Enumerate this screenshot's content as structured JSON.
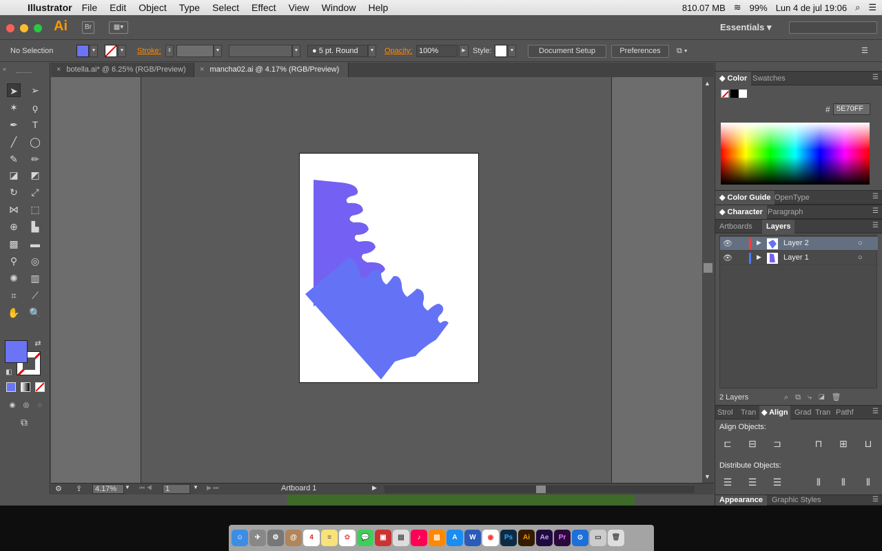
{
  "menubar": {
    "app": "Illustrator",
    "items": [
      "File",
      "Edit",
      "Object",
      "Type",
      "Select",
      "Effect",
      "View",
      "Window",
      "Help"
    ],
    "memory": "810.07 MB",
    "battery": "99%",
    "datetime": "Lun 4 de jul  19:06"
  },
  "titlebar": {
    "logo": "Ai",
    "bridge": "Br",
    "workspace": "Essentials"
  },
  "control": {
    "selection": "No Selection",
    "fill_color": "#6b74f5",
    "stroke_label": "Stroke:",
    "brush": "5 pt. Round",
    "opacity_label": "Opacity:",
    "opacity": "100%",
    "style_label": "Style:",
    "document_setup": "Document Setup",
    "preferences": "Preferences"
  },
  "tabs": [
    {
      "label": "botella.ai* @ 6.25% (RGB/Preview)",
      "active": false
    },
    {
      "label": "mancha02.ai @ 4.17% (RGB/Preview)",
      "active": true
    }
  ],
  "status": {
    "zoom": "4.17%",
    "page": "1",
    "artboard": "Artboard 1"
  },
  "color_panel": {
    "tabs": [
      "Color",
      "Swatches"
    ],
    "hex_symbol": "#",
    "hex": "5E70FF"
  },
  "panels": {
    "color_guide_tabs": [
      "Color Guide",
      "OpenType"
    ],
    "character_tabs": [
      "Character",
      "Paragraph"
    ],
    "layers_tabs": [
      "Artboards",
      "Layers"
    ],
    "layers": [
      {
        "name": "Layer 2",
        "color": "#ff3b3b",
        "active": true
      },
      {
        "name": "Layer 1",
        "color": "#4a7bff",
        "active": false
      }
    ],
    "layers_count": "2 Layers",
    "lower_tabs": [
      "Strol",
      "Tran",
      "Align",
      "Grad",
      "Tran",
      "Pathf"
    ],
    "align_objects": "Align Objects:",
    "distribute_objects": "Distribute Objects:",
    "bottom_tabs": [
      "Appearance",
      "Graphic Styles"
    ]
  },
  "art": {
    "shape1_color": "#7460f2",
    "shape2_color": "#6472f5"
  },
  "dock": [
    "Finder",
    "Launchpad",
    "System Preferences",
    "Contacts",
    "Calendar",
    "Notes",
    "Photos",
    "Messages",
    "Photo Booth",
    "Preview",
    "iTunes",
    "iBooks",
    "App Store",
    "Word",
    "Chrome",
    "Ps",
    "Ai",
    "Ae",
    "Pr",
    "Safari",
    "Utilities",
    "Trash"
  ]
}
